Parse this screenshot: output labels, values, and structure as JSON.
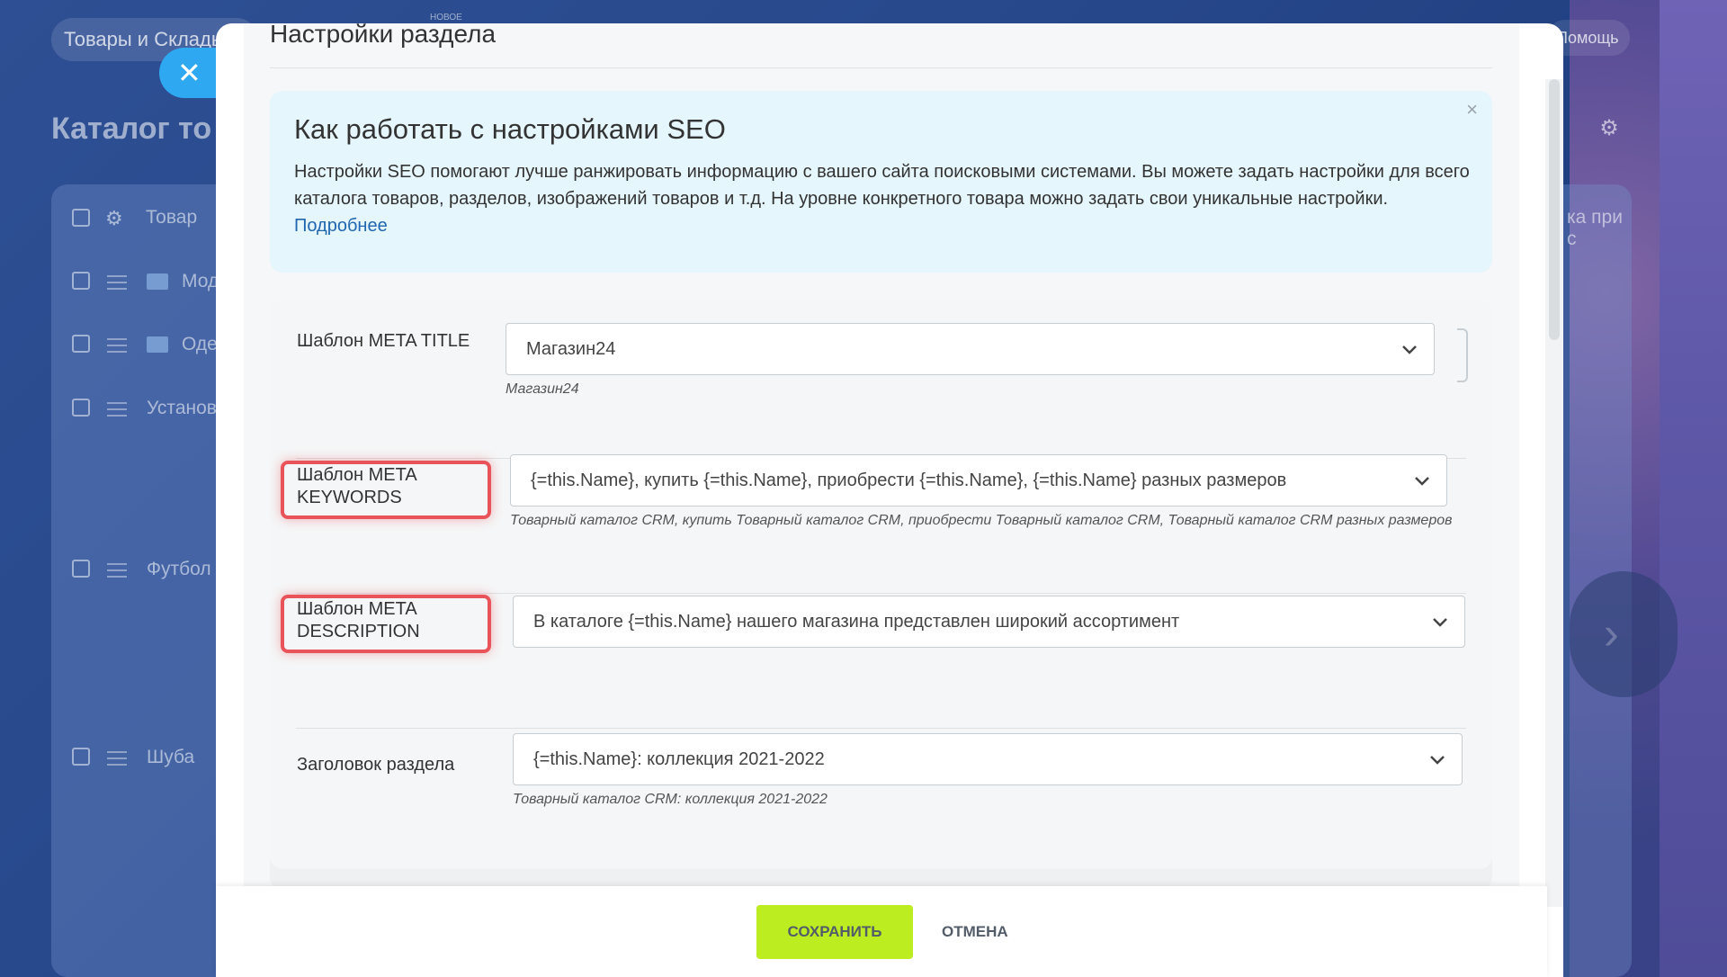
{
  "background_app": {
    "search_text": "Товары и Склады",
    "new_badge": "НОВОЕ",
    "help_text": "Помощь",
    "page_title": "Каталог то",
    "column_header": "Товар",
    "column_right": "ка при с",
    "rows": [
      "Мод",
      "Оде",
      "Установ",
      "Футбол",
      "Шуба"
    ]
  },
  "panel": {
    "close_icon": "close-icon",
    "title": "Настройки раздела"
  },
  "info": {
    "title": "Как работать с настройками SEO",
    "text": "Настройки SEO помогают лучше ранжировать информацию с вашего сайта поисковыми системами. Вы можете задать настройки для всего каталога товаров, разделов, изображений товаров и т.д. На уровне конкретного товара можно задать свои уникальные настройки.",
    "link": "Подробнее",
    "close": "×"
  },
  "form": {
    "meta_title": {
      "label": "Шаблон META TITLE",
      "value": "Магазин24",
      "hint": "Магазин24"
    },
    "meta_keywords": {
      "label": "Шаблон META KEYWORDS",
      "value": "{=this.Name}, купить {=this.Name}, приобрести {=this.Name}, {=this.Name} разных размеров",
      "hint": "Товарный каталог CRM, купить Товарный каталог CRM, приобрести Товарный каталог CRM, Товарный каталог CRM разных размеров"
    },
    "meta_description": {
      "label": "Шаблон META DESCRIPTION",
      "value": "В каталоге {=this.Name} нашего магазина представлен широкий ассортимент"
    },
    "section_heading": {
      "label": "Заголовок раздела",
      "value": "{=this.Name}: коллекция 2021-2022",
      "hint": "Товарный каталог CRM: коллекция 2021-2022"
    }
  },
  "footer": {
    "save": "СОХРАНИТЬ",
    "cancel": "ОТМЕНА"
  },
  "colors": {
    "save_button": "#bbed21",
    "highlight": "#e8545a",
    "info_bg": "#e5f6fd",
    "link": "#2067b0"
  }
}
